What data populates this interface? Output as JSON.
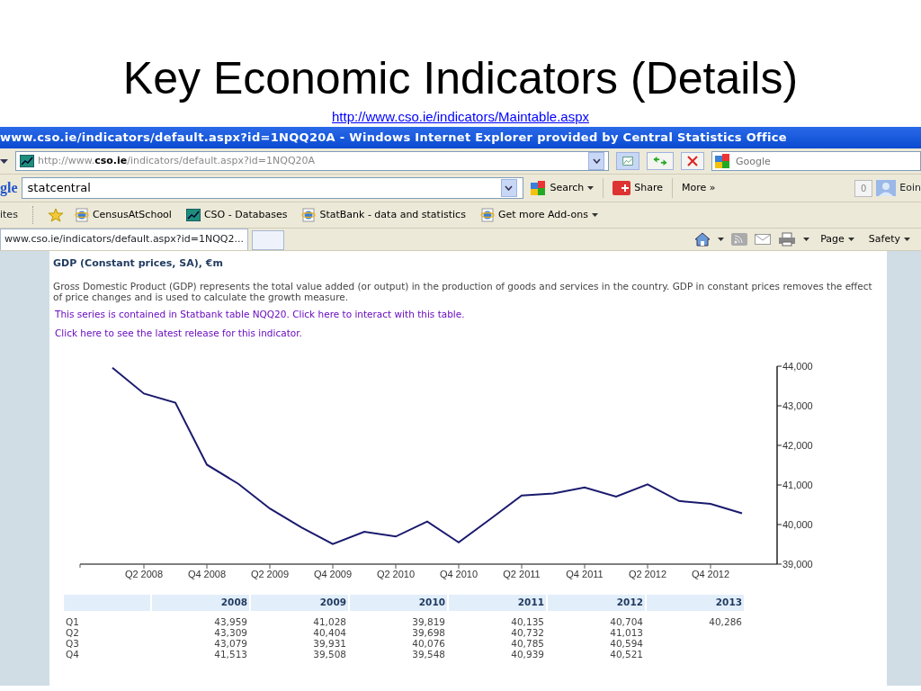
{
  "slide": {
    "title": "Key Economic Indicators (Details)",
    "link": "http://www.cso.ie/indicators/Maintable.aspx"
  },
  "browser": {
    "title": "www.cso.ie/indicators/default.aspx?id=1NQQ20A - Windows Internet Explorer provided by Central Statistics Office",
    "address": "http://www.**cso.ie**/indicators/default.aspx?id=1NQQ20A",
    "search": {
      "placeholder": "Google"
    },
    "toolbar": {
      "logo": "gle",
      "query": "statcentral",
      "buttons": [
        {
          "kind": "search",
          "label": "Search"
        },
        {
          "kind": "share",
          "label": "Share"
        },
        {
          "kind": "more",
          "label": "More »"
        }
      ],
      "counter": "0",
      "user": "Eoin"
    },
    "favorites": {
      "label": "ites",
      "items": [
        {
          "kind": "ie",
          "label": "CensusAtSchool"
        },
        {
          "kind": "cso",
          "label": "CSO - Databases"
        },
        {
          "kind": "ie",
          "label": "StatBank - data and statistics"
        },
        {
          "kind": "ie-menu",
          "label": "Get more Add-ons"
        }
      ]
    },
    "tabs": [
      {
        "label": "www.cso.ie/indicators/default.aspx?id=1NQQ2...",
        "selected": true
      }
    ],
    "commands": [
      "Page",
      "Safety"
    ]
  },
  "page": {
    "heading": "GDP (Constant prices, SA), €m",
    "description": "Gross Domestic Product (GDP) represents the total value added (or output) in the production of goods and services in the country. GDP in constant prices removes the effect of price changes and is used to calculate the growth measure.",
    "links": [
      "This series is contained in Statbank table NQQ20. Click here to interact with this table.",
      "Click here to see the latest release for this indicator."
    ],
    "chart_data": {
      "type": "line",
      "categories": [
        null,
        "Q2 2008",
        null,
        "Q4 2008",
        null,
        "Q2 2009",
        null,
        "Q4 2009",
        null,
        "Q2 2010",
        null,
        "Q4 2010",
        null,
        "Q2 2011",
        null,
        "Q4 2011",
        null,
        "Q2 2012",
        null,
        "Q4 2012",
        null
      ],
      "series": [
        {
          "color": "#1a1a6e",
          "values": [
            43959,
            43309,
            43079,
            41513,
            41028,
            40404,
            39931,
            39508,
            39819,
            39698,
            40076,
            39548,
            40135,
            40732,
            40785,
            40939,
            40704,
            41013,
            40594,
            40521,
            40286
          ]
        }
      ],
      "ylim": [
        39000,
        44000
      ],
      "yticks": [
        {
          "value": 39000,
          "label": "39,000"
        },
        {
          "value": 40000,
          "label": "40,000"
        },
        {
          "value": 41000,
          "label": "41,000"
        },
        {
          "value": 42000,
          "label": "42,000"
        },
        {
          "value": 43000,
          "label": "43,000"
        },
        {
          "value": 44000,
          "label": "44,000"
        }
      ]
    },
    "table": {
      "columns": [
        "2008",
        "2009",
        "2010",
        "2011",
        "2012",
        "2013"
      ],
      "rows": [
        {
          "label": "Q1",
          "cells": [
            "43,959",
            "41,028",
            "39,819",
            "40,135",
            "40,704",
            "40,286"
          ]
        },
        {
          "label": "Q2",
          "cells": [
            "43,309",
            "40,404",
            "39,698",
            "40,732",
            "41,013"
          ]
        },
        {
          "label": "Q3",
          "cells": [
            "43,079",
            "39,931",
            "40,076",
            "40,785",
            "40,594"
          ]
        },
        {
          "label": "Q4",
          "cells": [
            "41,513",
            "39,508",
            "39,548",
            "40,939",
            "40,521"
          ]
        }
      ]
    }
  }
}
